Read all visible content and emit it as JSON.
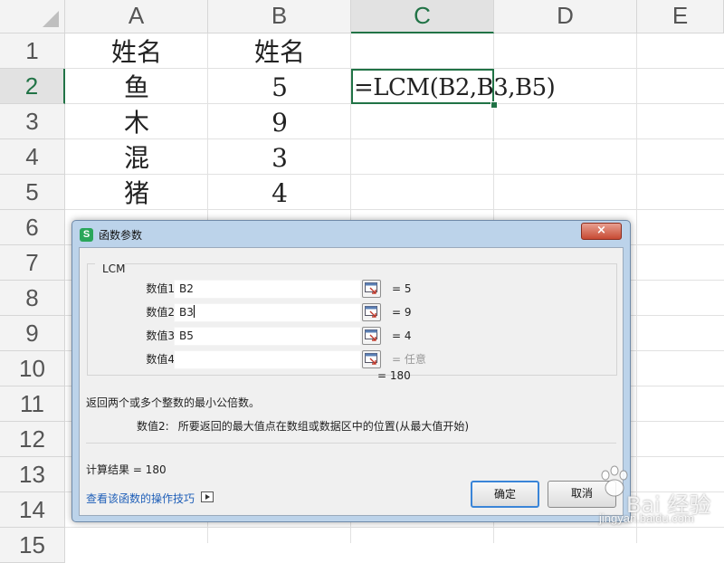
{
  "sheet": {
    "columns": [
      "A",
      "B",
      "C",
      "D",
      "E"
    ],
    "rows": [
      "1",
      "2",
      "3",
      "4",
      "5",
      "6",
      "7",
      "8",
      "9",
      "10",
      "11",
      "12",
      "13",
      "14",
      "15"
    ],
    "active_column": "C",
    "active_row": "2",
    "cells": {
      "a1": "姓名",
      "b1": "姓名",
      "a2": "鱼",
      "b2": "5",
      "a3": "木",
      "b3": "9",
      "a4": "混",
      "b4": "3",
      "a5": "猪",
      "b5": "4"
    },
    "formula": "=LCM(B2,B3,B5)"
  },
  "dialog": {
    "title": "函数参数",
    "close_label": "×",
    "function_name": "LCM",
    "args": [
      {
        "label": "数值1",
        "value": "B2",
        "result": "= 5"
      },
      {
        "label": "数值2",
        "value": "B3",
        "result": "= 9"
      },
      {
        "label": "数值3",
        "value": "B5",
        "result": "= 4"
      },
      {
        "label": "数值4",
        "value": "",
        "result": "= 任意"
      }
    ],
    "formula_result": "=  180",
    "description": "返回两个或多个整数的最小公倍数。",
    "param_name": "数值2:",
    "param_description": "所要返回的最大值点在数组或数据区中的位置(从最大值开始)",
    "calc_result": "计算结果 =  180",
    "help_link": "查看该函数的操作技巧",
    "ok_label": "确定",
    "cancel_label": "取消"
  },
  "watermark": {
    "brand": "Bai 经验",
    "url": "jingyan.baidu.com"
  }
}
